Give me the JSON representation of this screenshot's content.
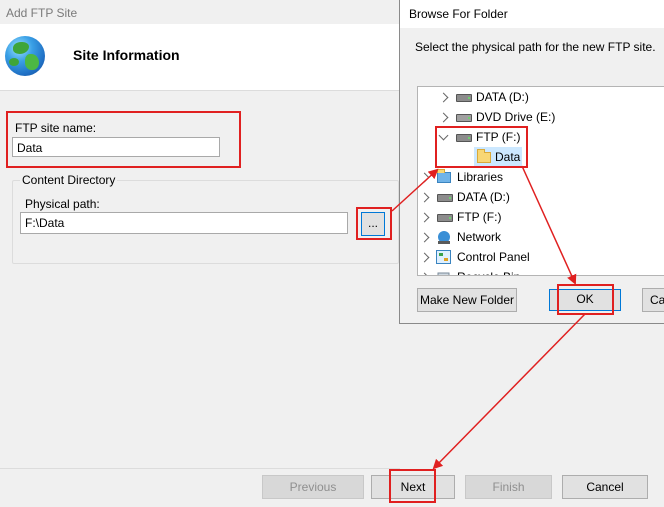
{
  "wizard": {
    "title": "Add FTP Site",
    "section_title": "Site Information",
    "site_name_label": "FTP site name:",
    "site_name_value": "Data",
    "content_directory_label": "Content Directory",
    "physical_path_label": "Physical path:",
    "physical_path_value": "F:\\Data",
    "browse_label": "...",
    "buttons": {
      "previous": "Previous",
      "next": "Next",
      "finish": "Finish",
      "cancel": "Cancel"
    }
  },
  "browse_dialog": {
    "title": "Browse For Folder",
    "description": "Select the physical path for the new FTP site.",
    "tree": [
      {
        "label": "DATA (D:)",
        "icon": "drive-icon",
        "expanded": false
      },
      {
        "label": "DVD Drive (E:)",
        "icon": "dvd-drive-icon",
        "expanded": false
      },
      {
        "label": "FTP (F:)",
        "icon": "drive-icon",
        "expanded": true
      },
      {
        "label": "Data",
        "icon": "folder-icon",
        "selected": true
      },
      {
        "label": "Libraries",
        "icon": "libraries-icon",
        "expanded": false
      },
      {
        "label": "DATA (D:)",
        "icon": "drive-icon",
        "expanded": false
      },
      {
        "label": "FTP (F:)",
        "icon": "drive-icon",
        "expanded": false
      },
      {
        "label": "Network",
        "icon": "network-icon",
        "expanded": false
      },
      {
        "label": "Control Panel",
        "icon": "control-panel-icon",
        "expanded": false
      },
      {
        "label": "Recycle Bin",
        "icon": "recycle-bin-icon",
        "expanded": false
      }
    ],
    "buttons": {
      "make_new_folder": "Make New Folder",
      "ok": "OK",
      "cancel": "Cancel"
    }
  },
  "colors": {
    "annotation": "#e02020",
    "selection": "#cce8ff",
    "focus_border": "#0078d7"
  }
}
